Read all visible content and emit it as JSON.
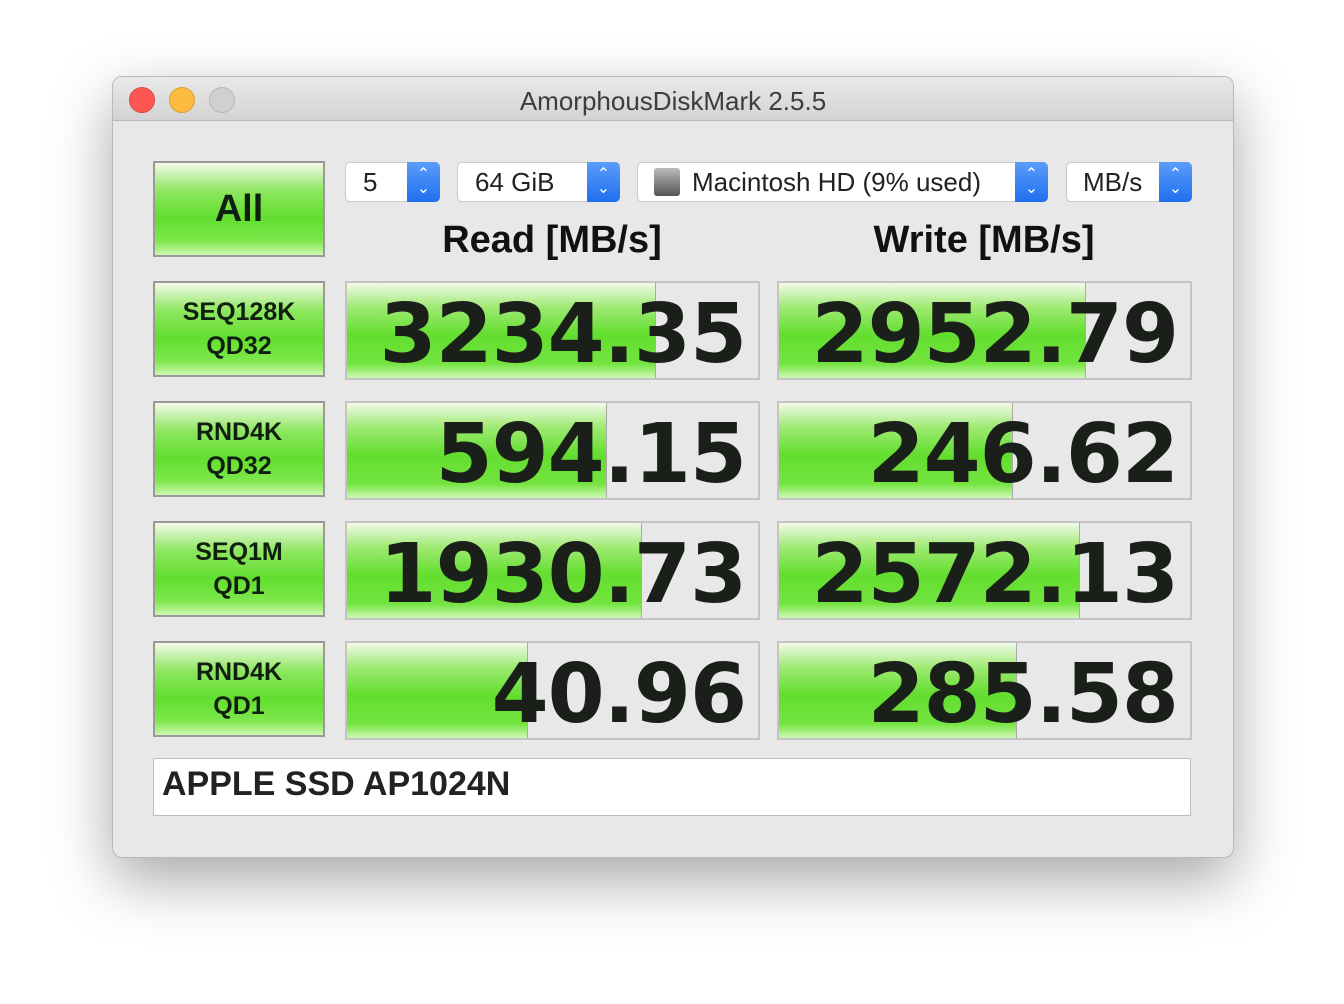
{
  "window": {
    "title": "AmorphousDiskMark 2.5.5"
  },
  "controls": {
    "all_label": "All",
    "count": "5",
    "size": "64 GiB",
    "drive": "Macintosh HD (9% used)",
    "unit": "MB/s",
    "drive_icon": "hard-disk-icon",
    "arrow_icon": "chevron-updown-icon"
  },
  "headers": {
    "read": "Read [MB/s]",
    "write": "Write [MB/s]"
  },
  "tests": [
    {
      "line1": "SEQ128K",
      "line2": "QD32",
      "read": "3234.35",
      "write": "2952.79",
      "read_fill": 0.75,
      "write_fill": 0.744
    },
    {
      "line1": "RND4K",
      "line2": "QD32",
      "read": "594.15",
      "write": "246.62",
      "read_fill": 0.63,
      "write_fill": 0.567
    },
    {
      "line1": "SEQ1M",
      "line2": "QD1",
      "read": "1930.73",
      "write": "2572.13",
      "read_fill": 0.715,
      "write_fill": 0.729
    },
    {
      "line1": "RND4K",
      "line2": "QD1",
      "read": "40.96",
      "write": "285.58",
      "read_fill": 0.437,
      "write_fill": 0.577
    }
  ],
  "model": "APPLE SSD AP1024N",
  "colors": {
    "close": "#fc5753",
    "minimize": "#fdbc40",
    "zoom": "#d0d0d0",
    "accent": "#62de2e",
    "select": "#2a76f2"
  }
}
